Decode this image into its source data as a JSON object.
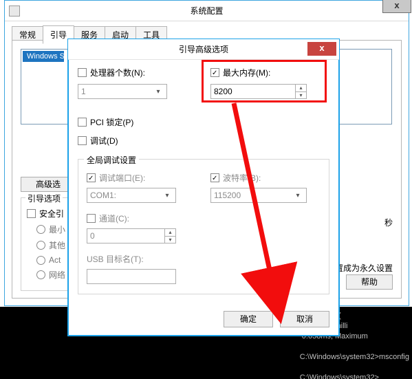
{
  "base": {
    "title": "系统配置",
    "close": "x",
    "tabs": [
      "常规",
      "引导",
      "服务",
      "启动",
      "工具"
    ],
    "listitem": "Windows S",
    "adv_btn": "高级选",
    "boot_group_title": "引导选项",
    "safe_boot": "安全引",
    "radios": [
      "最小",
      "其他",
      "Act",
      "网络"
    ],
    "sec_text": "秒",
    "perm_text": "置成为永久设置",
    "help_btn": "帮助"
  },
  "dlg": {
    "title": "引导高级选项",
    "close": "x",
    "cpu_label": "处理器个数(N):",
    "cpu_value": "1",
    "mem_label": "最大内存(M):",
    "mem_value": "8200",
    "pci_label": "PCI 锁定(P)",
    "debug_label": "调试(D)",
    "group_title": "全局调试设置",
    "debug_port_label": "调试端口(E):",
    "debug_port_value": "COM1:",
    "baud_label": "波特率(B):",
    "baud_value": "115200",
    "channel_label": "通道(C):",
    "channel_value": "0",
    "usb_label": "USB 目标名(T):",
    "usb_value": "",
    "ok": "确定",
    "cancel": "取消"
  },
  "console": {
    "line1_right": "l, 0 failed.   (",
    "line2_right": ")  times in milli",
    "line3_right": " 0.058ms, Maximum",
    "line4": "C:\\Windows\\system32>msconfig",
    "line5": "C:\\Windows\\system32>"
  }
}
